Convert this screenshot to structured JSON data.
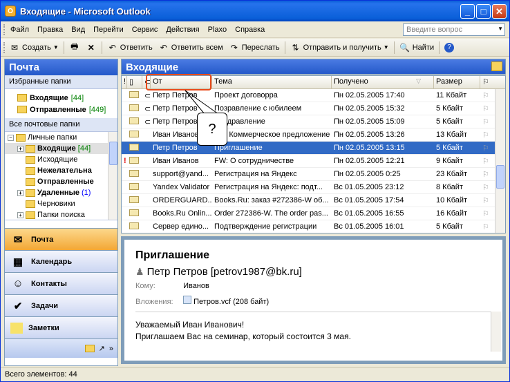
{
  "window": {
    "title": "Входящие - Microsoft Outlook",
    "minimize": "_",
    "maximize": "□",
    "close": "✕"
  },
  "menu": [
    "Файл",
    "Правка",
    "Вид",
    "Перейти",
    "Сервис",
    "Действия",
    "Plaxo",
    "Справка"
  ],
  "help_box": {
    "placeholder": "Введите вопрос"
  },
  "toolbar": {
    "new": "Создать",
    "reply": "Ответить",
    "reply_all": "Ответить всем",
    "forward": "Переслать",
    "send_receive": "Отправить и получить",
    "find": "Найти"
  },
  "nav": {
    "header": "Почта",
    "favorites_header": "Избранные папки",
    "favorites": [
      {
        "label": "Входящие",
        "count": "[44]"
      },
      {
        "label": "Отправленные",
        "count": "[449]"
      }
    ],
    "all_folders_header": "Все почтовые папки",
    "tree": [
      {
        "label": "Личные папки",
        "count": ""
      },
      {
        "label": "Входящие",
        "count": "[44]"
      },
      {
        "label": "Исходящие",
        "count": ""
      },
      {
        "label": "Нежелательна",
        "count": ""
      },
      {
        "label": "Отправленные",
        "count": ""
      },
      {
        "label": "Удаленные",
        "count": "(1)"
      },
      {
        "label": "Черновики",
        "count": ""
      },
      {
        "label": "Папки поиска",
        "count": ""
      }
    ],
    "buttons": [
      "Почта",
      "Календарь",
      "Контакты",
      "Задачи",
      "Заметки"
    ]
  },
  "main": {
    "header": "Входящие",
    "columns": {
      "from": "От",
      "subject": "Тема",
      "received": "Получено",
      "size": "Размер"
    },
    "rows": [
      {
        "from": "Петр Петров",
        "subject": "Проект договорра",
        "received": "Пн 02.05.2005 17:40",
        "size": "11 Кбайт"
      },
      {
        "from": "Петр Петров",
        "subject": "Позравление с юбилеем",
        "received": "Пн 02.05.2005 15:32",
        "size": "5 Кбайт"
      },
      {
        "from": "Петр Петров",
        "subject": "Поздравление",
        "received": "Пн 02.05.2005 15:09",
        "size": "5 Кбайт"
      },
      {
        "from": "Иван Иванов",
        "subject": "RE: Коммерческое предложение",
        "received": "Пн 02.05.2005 13:26",
        "size": "13 Кбайт"
      },
      {
        "from": "Петр Петров",
        "subject": "Приглашение",
        "received": "Пн 02.05.2005 13:15",
        "size": "5 Кбайт"
      },
      {
        "from": "Иван Иванов",
        "subject": "FW: О сотрудничестве",
        "received": "Пн 02.05.2005 12:21",
        "size": "9 Кбайт"
      },
      {
        "from": "support@yand...",
        "subject": "Регистрация на Яндекс",
        "received": "Пн 02.05.2005 0:25",
        "size": "23 Кбайт"
      },
      {
        "from": "Yandex Validator",
        "subject": "Регистрация на Яндекс: подт...",
        "received": "Вс 01.05.2005 23:12",
        "size": "8 Кбайт"
      },
      {
        "from": "ORDERGUARD...",
        "subject": "Books.Ru: заказ #272386-W об...",
        "received": "Вс 01.05.2005 17:54",
        "size": "10 Кбайт"
      },
      {
        "from": "Books.Ru Onlin...",
        "subject": "Order 272386-W. The order pas...",
        "received": "Вс 01.05.2005 16:55",
        "size": "16 Кбайт"
      },
      {
        "from": "Сервер едино...",
        "subject": "Подтверждение регистрации",
        "received": "Вс 01.05.2005 16:01",
        "size": "5 Кбайт"
      }
    ],
    "callout": "?"
  },
  "reading": {
    "subject": "Приглашение",
    "from": "Петр Петров [petrov1987@bk.ru]",
    "to_label": "Кому:",
    "to": "Иванов",
    "attach_label": "Вложения:",
    "attachment": "Петров.vcf (208 байт)",
    "body_line1": "Уважаемый Иван Иванович!",
    "body_line2": "Приглашаем Вас на семинар, который состоится 3 мая."
  },
  "status": "Всего элементов: 44"
}
